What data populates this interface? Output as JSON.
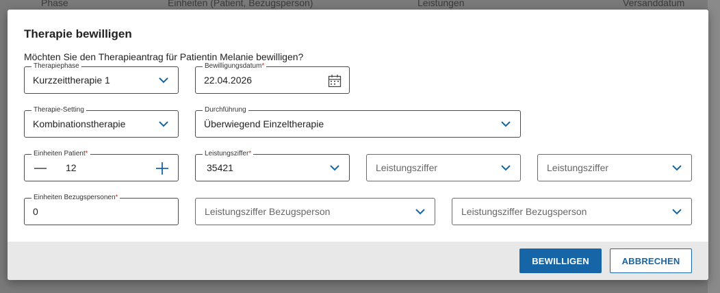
{
  "background": {
    "columns": [
      "Phase",
      "Einheiten (Patient, Bezugsperson)",
      "Leistungen",
      "Versanddatum"
    ]
  },
  "dialog": {
    "title": "Therapie bewilligen",
    "question": "Möchten Sie den Therapieantrag für Patientin Melanie bewilligen?"
  },
  "fields": {
    "therapiephase": {
      "label": "Therapiephase",
      "value": "Kurzzeittherapie 1"
    },
    "bewilligungsdatum": {
      "label": "Bewilligungsdatum",
      "required": "*",
      "value": "22.04.2026"
    },
    "setting": {
      "label": "Therapie-Setting",
      "value": "Kombinationstherapie"
    },
    "durchfuehrung": {
      "label": "Durchführung",
      "value": "Überwiegend Einzeltherapie"
    },
    "einheiten_patient": {
      "label": "Einheiten Patient",
      "required": "*",
      "value": "12"
    },
    "leistungsziffer_1": {
      "label": "Leistungsziffer",
      "required": "*",
      "value": "35421"
    },
    "leistungsziffer_2": {
      "placeholder": "Leistungsziffer"
    },
    "leistungsziffer_3": {
      "placeholder": "Leistungsziffer"
    },
    "einheiten_bezugspersonen": {
      "label": "Einheiten Bezugspersonen",
      "required": "*",
      "value": "0"
    },
    "leistungsziffer_bezug_1": {
      "placeholder": "Leistungsziffer Bezugsperson"
    },
    "leistungsziffer_bezug_2": {
      "placeholder": "Leistungsziffer Bezugsperson"
    }
  },
  "buttons": {
    "approve": "BEWILLIGEN",
    "cancel": "ABBRECHEN"
  },
  "colors": {
    "primary": "#1565a7",
    "required": "#c0392b",
    "footer": "#e8e8e8"
  },
  "icons": {
    "dropdown": "chevron-down-icon",
    "date": "calendar-icon",
    "decrement": "minus-icon",
    "increment": "plus-icon"
  }
}
